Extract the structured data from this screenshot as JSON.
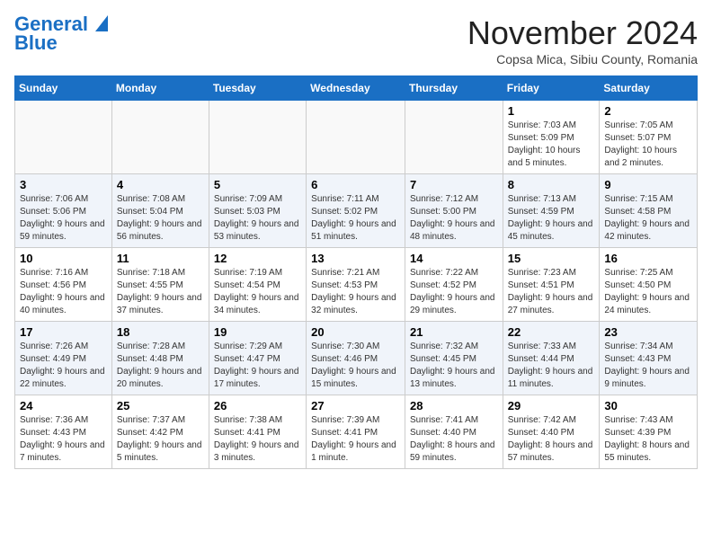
{
  "header": {
    "logo_line1": "General",
    "logo_line2": "Blue",
    "month_title": "November 2024",
    "location": "Copsa Mica, Sibiu County, Romania"
  },
  "weekdays": [
    "Sunday",
    "Monday",
    "Tuesday",
    "Wednesday",
    "Thursday",
    "Friday",
    "Saturday"
  ],
  "weeks": [
    [
      {
        "day": "",
        "info": ""
      },
      {
        "day": "",
        "info": ""
      },
      {
        "day": "",
        "info": ""
      },
      {
        "day": "",
        "info": ""
      },
      {
        "day": "",
        "info": ""
      },
      {
        "day": "1",
        "info": "Sunrise: 7:03 AM\nSunset: 5:09 PM\nDaylight: 10 hours and 5 minutes."
      },
      {
        "day": "2",
        "info": "Sunrise: 7:05 AM\nSunset: 5:07 PM\nDaylight: 10 hours and 2 minutes."
      }
    ],
    [
      {
        "day": "3",
        "info": "Sunrise: 7:06 AM\nSunset: 5:06 PM\nDaylight: 9 hours and 59 minutes."
      },
      {
        "day": "4",
        "info": "Sunrise: 7:08 AM\nSunset: 5:04 PM\nDaylight: 9 hours and 56 minutes."
      },
      {
        "day": "5",
        "info": "Sunrise: 7:09 AM\nSunset: 5:03 PM\nDaylight: 9 hours and 53 minutes."
      },
      {
        "day": "6",
        "info": "Sunrise: 7:11 AM\nSunset: 5:02 PM\nDaylight: 9 hours and 51 minutes."
      },
      {
        "day": "7",
        "info": "Sunrise: 7:12 AM\nSunset: 5:00 PM\nDaylight: 9 hours and 48 minutes."
      },
      {
        "day": "8",
        "info": "Sunrise: 7:13 AM\nSunset: 4:59 PM\nDaylight: 9 hours and 45 minutes."
      },
      {
        "day": "9",
        "info": "Sunrise: 7:15 AM\nSunset: 4:58 PM\nDaylight: 9 hours and 42 minutes."
      }
    ],
    [
      {
        "day": "10",
        "info": "Sunrise: 7:16 AM\nSunset: 4:56 PM\nDaylight: 9 hours and 40 minutes."
      },
      {
        "day": "11",
        "info": "Sunrise: 7:18 AM\nSunset: 4:55 PM\nDaylight: 9 hours and 37 minutes."
      },
      {
        "day": "12",
        "info": "Sunrise: 7:19 AM\nSunset: 4:54 PM\nDaylight: 9 hours and 34 minutes."
      },
      {
        "day": "13",
        "info": "Sunrise: 7:21 AM\nSunset: 4:53 PM\nDaylight: 9 hours and 32 minutes."
      },
      {
        "day": "14",
        "info": "Sunrise: 7:22 AM\nSunset: 4:52 PM\nDaylight: 9 hours and 29 minutes."
      },
      {
        "day": "15",
        "info": "Sunrise: 7:23 AM\nSunset: 4:51 PM\nDaylight: 9 hours and 27 minutes."
      },
      {
        "day": "16",
        "info": "Sunrise: 7:25 AM\nSunset: 4:50 PM\nDaylight: 9 hours and 24 minutes."
      }
    ],
    [
      {
        "day": "17",
        "info": "Sunrise: 7:26 AM\nSunset: 4:49 PM\nDaylight: 9 hours and 22 minutes."
      },
      {
        "day": "18",
        "info": "Sunrise: 7:28 AM\nSunset: 4:48 PM\nDaylight: 9 hours and 20 minutes."
      },
      {
        "day": "19",
        "info": "Sunrise: 7:29 AM\nSunset: 4:47 PM\nDaylight: 9 hours and 17 minutes."
      },
      {
        "day": "20",
        "info": "Sunrise: 7:30 AM\nSunset: 4:46 PM\nDaylight: 9 hours and 15 minutes."
      },
      {
        "day": "21",
        "info": "Sunrise: 7:32 AM\nSunset: 4:45 PM\nDaylight: 9 hours and 13 minutes."
      },
      {
        "day": "22",
        "info": "Sunrise: 7:33 AM\nSunset: 4:44 PM\nDaylight: 9 hours and 11 minutes."
      },
      {
        "day": "23",
        "info": "Sunrise: 7:34 AM\nSunset: 4:43 PM\nDaylight: 9 hours and 9 minutes."
      }
    ],
    [
      {
        "day": "24",
        "info": "Sunrise: 7:36 AM\nSunset: 4:43 PM\nDaylight: 9 hours and 7 minutes."
      },
      {
        "day": "25",
        "info": "Sunrise: 7:37 AM\nSunset: 4:42 PM\nDaylight: 9 hours and 5 minutes."
      },
      {
        "day": "26",
        "info": "Sunrise: 7:38 AM\nSunset: 4:41 PM\nDaylight: 9 hours and 3 minutes."
      },
      {
        "day": "27",
        "info": "Sunrise: 7:39 AM\nSunset: 4:41 PM\nDaylight: 9 hours and 1 minute."
      },
      {
        "day": "28",
        "info": "Sunrise: 7:41 AM\nSunset: 4:40 PM\nDaylight: 8 hours and 59 minutes."
      },
      {
        "day": "29",
        "info": "Sunrise: 7:42 AM\nSunset: 4:40 PM\nDaylight: 8 hours and 57 minutes."
      },
      {
        "day": "30",
        "info": "Sunrise: 7:43 AM\nSunset: 4:39 PM\nDaylight: 8 hours and 55 minutes."
      }
    ]
  ]
}
